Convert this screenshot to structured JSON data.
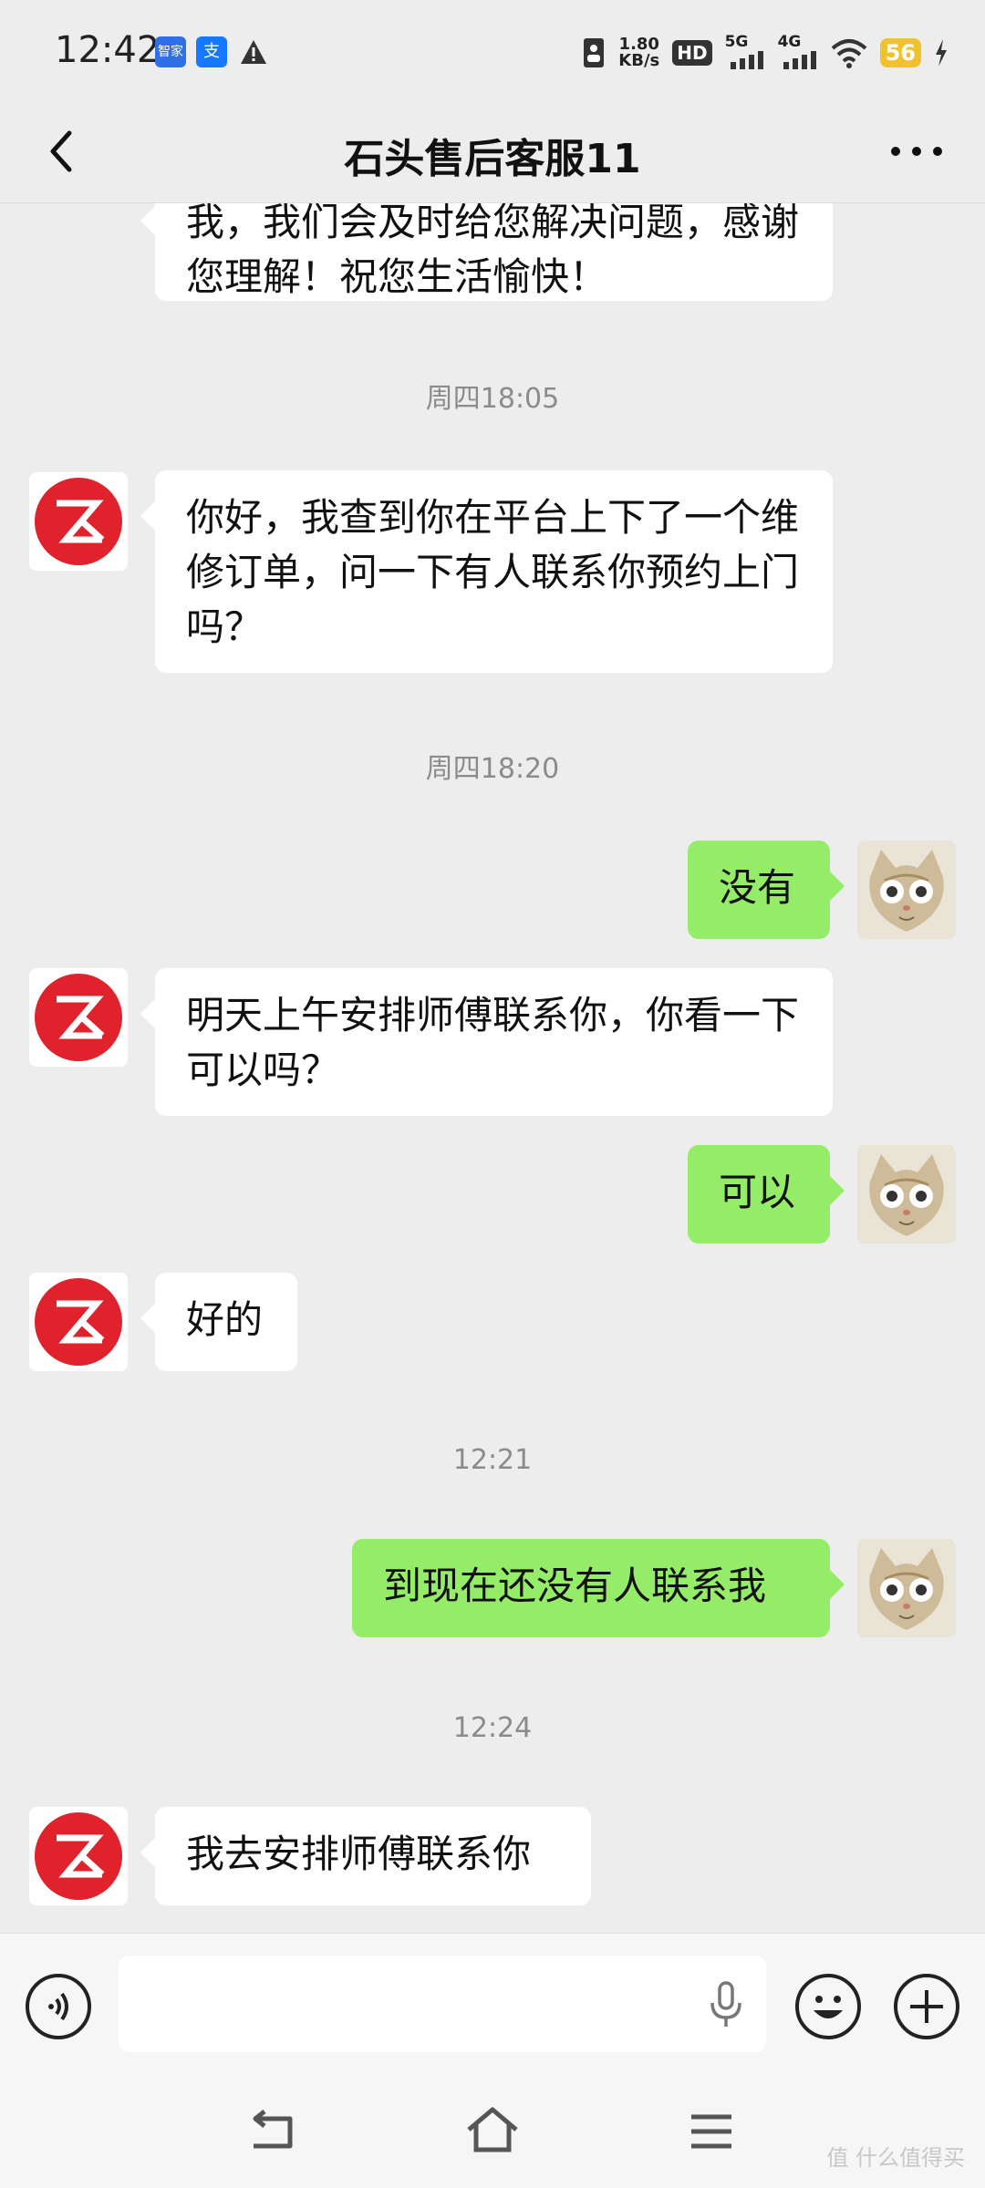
{
  "status_bar": {
    "time": "12:42",
    "app_icons": [
      "智家",
      "支"
    ],
    "speed_value": "1.80",
    "speed_unit": "KB/s",
    "hd_label": "HD",
    "net1": "5G",
    "net2": "4G",
    "battery": "56"
  },
  "header": {
    "title": "石头售后客服11"
  },
  "messages": [
    {
      "type": "in",
      "text": "我，我们会及时给您解决问题，感谢您理解！祝您生活愉快！"
    },
    {
      "type": "time",
      "text": "周四18:05"
    },
    {
      "type": "in",
      "text": "你好，我查到你在平台上下了一个维修订单，问一下有人联系你预约上门吗？"
    },
    {
      "type": "time",
      "text": "周四18:20"
    },
    {
      "type": "out",
      "text": "没有"
    },
    {
      "type": "in",
      "text": "明天上午安排师傅联系你，你看一下可以吗？"
    },
    {
      "type": "out",
      "text": "可以"
    },
    {
      "type": "in",
      "text": "好的"
    },
    {
      "type": "time",
      "text": "12:21"
    },
    {
      "type": "out",
      "text": "到现在还没有人联系我"
    },
    {
      "type": "time",
      "text": "12:24"
    },
    {
      "type": "in",
      "text": "我去安排师傅联系你"
    }
  ],
  "watermark": "值 什么值得买",
  "colors": {
    "outgoing_bubble": "#95ec69",
    "incoming_bubble": "#ffffff",
    "background": "#ededed",
    "brand_red": "#e0222c"
  }
}
